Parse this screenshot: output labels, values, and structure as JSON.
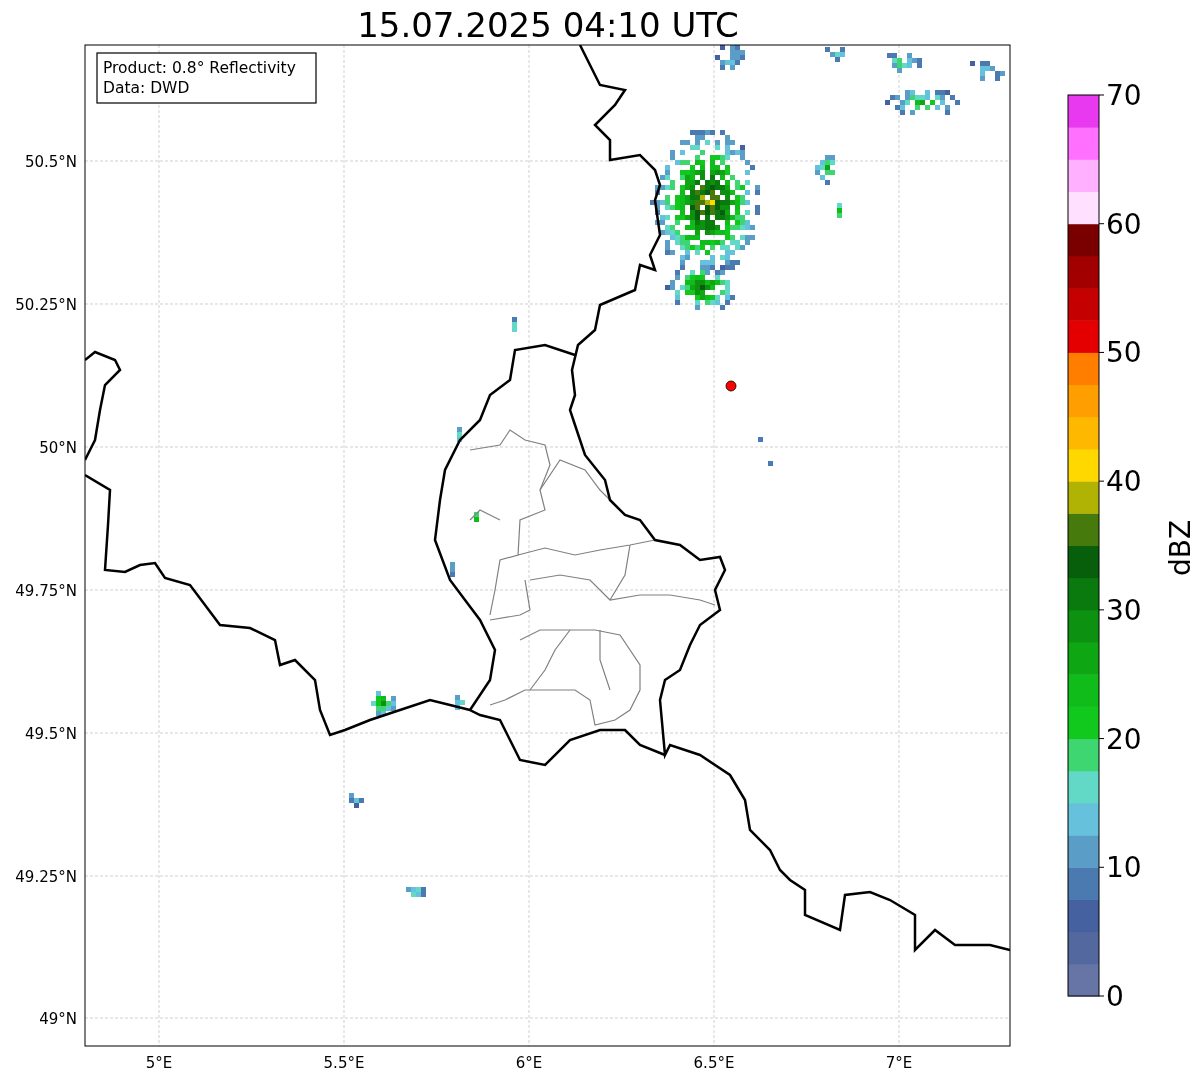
{
  "title": "15.07.2025 04:10 UTC",
  "info_box": [
    "Product: 0.8° Reflectivity",
    "Data: DWD"
  ],
  "y_ticks": [
    "50.5°N",
    "50.25°N",
    "50°N",
    "49.75°N",
    "49.5°N",
    "49.25°N",
    "49°N"
  ],
  "x_ticks": [
    "5°E",
    "5.5°E",
    "6°E",
    "6.5°E",
    "7°E"
  ],
  "colorbar": {
    "label": "dBZ",
    "ticks": [
      "70",
      "60",
      "50",
      "40",
      "30",
      "20",
      "10",
      "0"
    ],
    "segments": [
      {
        "color": "#6675a6"
      },
      {
        "color": "#5468a0"
      },
      {
        "color": "#4561a0"
      },
      {
        "color": "#4a7ab0"
      },
      {
        "color": "#5a9dc6"
      },
      {
        "color": "#66c2dc"
      },
      {
        "color": "#62d8c6"
      },
      {
        "color": "#3ed670"
      },
      {
        "color": "#10c91c"
      },
      {
        "color": "#0fbc1a"
      },
      {
        "color": "#0ea613"
      },
      {
        "color": "#0c9210"
      },
      {
        "color": "#0a7a0e"
      },
      {
        "color": "#075f0c"
      },
      {
        "color": "#477a0c"
      },
      {
        "color": "#b0b204"
      },
      {
        "color": "#ffd800"
      },
      {
        "color": "#ffb800"
      },
      {
        "color": "#ff9e00"
      },
      {
        "color": "#ff7e00"
      },
      {
        "color": "#e40000"
      },
      {
        "color": "#c40000"
      },
      {
        "color": "#a20000"
      },
      {
        "color": "#7a0000"
      },
      {
        "color": "#ffe0ff"
      },
      {
        "color": "#ffb0ff"
      },
      {
        "color": "#ff70ff"
      },
      {
        "color": "#e838f0"
      }
    ]
  }
}
